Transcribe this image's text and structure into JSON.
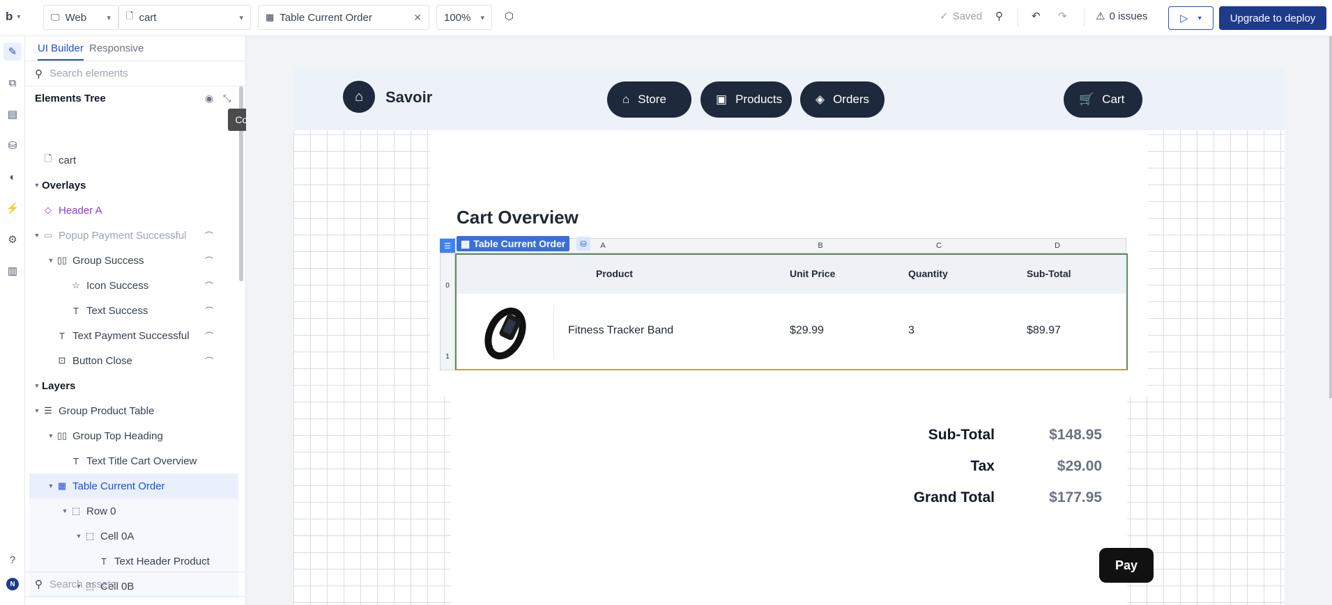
{
  "topbar": {
    "logo": "b",
    "platform": "Web",
    "page": "cart",
    "element": "Table Current Order",
    "zoom": "100%",
    "saved": "Saved",
    "issues": "0 issues",
    "upgrade": "Upgrade to deploy"
  },
  "sidebar": {
    "tab_builder": "UI Builder",
    "tab_responsive": "Responsive",
    "search_placeholder": "Search elements",
    "tree_title": "Elements Tree",
    "tooltip": "Collapse all",
    "assets_placeholder": "Search assets",
    "items": [
      {
        "label": "cart",
        "icon": "page-icon",
        "level": 0,
        "arrow": "",
        "hidden": false,
        "color": "#374151"
      },
      {
        "label": "Overlays",
        "icon": "",
        "level": 0,
        "arrow": "down",
        "hidden": false,
        "color": "#111827"
      },
      {
        "label": "Header A",
        "icon": "diamond-icon",
        "level": 0,
        "arrow": "",
        "hidden": false,
        "color": "#9333ea"
      },
      {
        "label": "Popup Payment Successful",
        "icon": "popup-icon",
        "level": 0,
        "arrow": "down",
        "hidden": true,
        "color": "#9ca3af"
      },
      {
        "label": "Group Success",
        "icon": "group-icon",
        "level": 1,
        "arrow": "down",
        "hidden": true,
        "color": "#374151"
      },
      {
        "label": "Icon Success",
        "icon": "star-icon",
        "level": 2,
        "arrow": "",
        "hidden": true,
        "color": "#374151"
      },
      {
        "label": "Text Success",
        "icon": "text-icon",
        "level": 2,
        "arrow": "",
        "hidden": true,
        "color": "#374151"
      },
      {
        "label": "Text Payment Successful",
        "icon": "text-icon",
        "level": 1,
        "arrow": "",
        "hidden": true,
        "color": "#374151"
      },
      {
        "label": "Button Close",
        "icon": "button-icon",
        "level": 1,
        "arrow": "",
        "hidden": true,
        "color": "#374151"
      },
      {
        "label": "Layers",
        "icon": "",
        "level": 0,
        "arrow": "down",
        "hidden": false,
        "color": "#111827"
      },
      {
        "label": "Group Product Table",
        "icon": "group-rows-icon",
        "level": 0,
        "arrow": "down",
        "hidden": false,
        "color": "#374151"
      },
      {
        "label": "Group Top Heading",
        "icon": "group-icon",
        "level": 1,
        "arrow": "down",
        "hidden": false,
        "color": "#374151"
      },
      {
        "label": "Text Title Cart Overview",
        "icon": "text-icon",
        "level": 2,
        "arrow": "",
        "hidden": false,
        "color": "#374151"
      },
      {
        "label": "Table Current Order",
        "icon": "table-icon",
        "level": 1,
        "arrow": "down",
        "hidden": false,
        "color": "#1d4ed8"
      },
      {
        "label": "Row 0",
        "icon": "dashed-box-icon",
        "level": 2,
        "arrow": "down",
        "hidden": false,
        "color": "#374151"
      },
      {
        "label": "Cell 0A",
        "icon": "dashed-box-icon",
        "level": 3,
        "arrow": "down",
        "hidden": false,
        "color": "#374151"
      },
      {
        "label": "Text Header Product",
        "icon": "text-icon",
        "level": 4,
        "arrow": "",
        "hidden": false,
        "color": "#374151"
      },
      {
        "label": "Cell 0B",
        "icon": "dashed-box-icon",
        "level": 3,
        "arrow": "down",
        "hidden": false,
        "color": "#374151"
      }
    ]
  },
  "canvas": {
    "brand": "Savoir",
    "nav": [
      {
        "label": "Store",
        "icon": "store-icon"
      },
      {
        "label": "Products",
        "icon": "box-icon"
      },
      {
        "label": "Orders",
        "icon": "tags-icon"
      }
    ],
    "cart": "Cart",
    "title": "Cart Overview",
    "table_label": "Table Current Order",
    "columns": [
      "A",
      "B",
      "C",
      "D"
    ],
    "rows_index": [
      "0",
      "1"
    ],
    "headers": [
      "Product",
      "Unit Price",
      "Quantity",
      "Sub-Total"
    ],
    "item": {
      "name": "Fitness Tracker Band",
      "price": "$29.99",
      "qty": "3",
      "subtotal": "$89.97"
    },
    "totals": [
      {
        "label": "Sub-Total",
        "value": "$148.95"
      },
      {
        "label": "Tax",
        "value": "$29.00"
      },
      {
        "label": "Grand Total",
        "value": "$177.95"
      }
    ],
    "pay": "Pay"
  },
  "colors": {
    "accent": "#1d4ed8",
    "deploy": "#1e3a8a",
    "nav": "#1e293b"
  }
}
